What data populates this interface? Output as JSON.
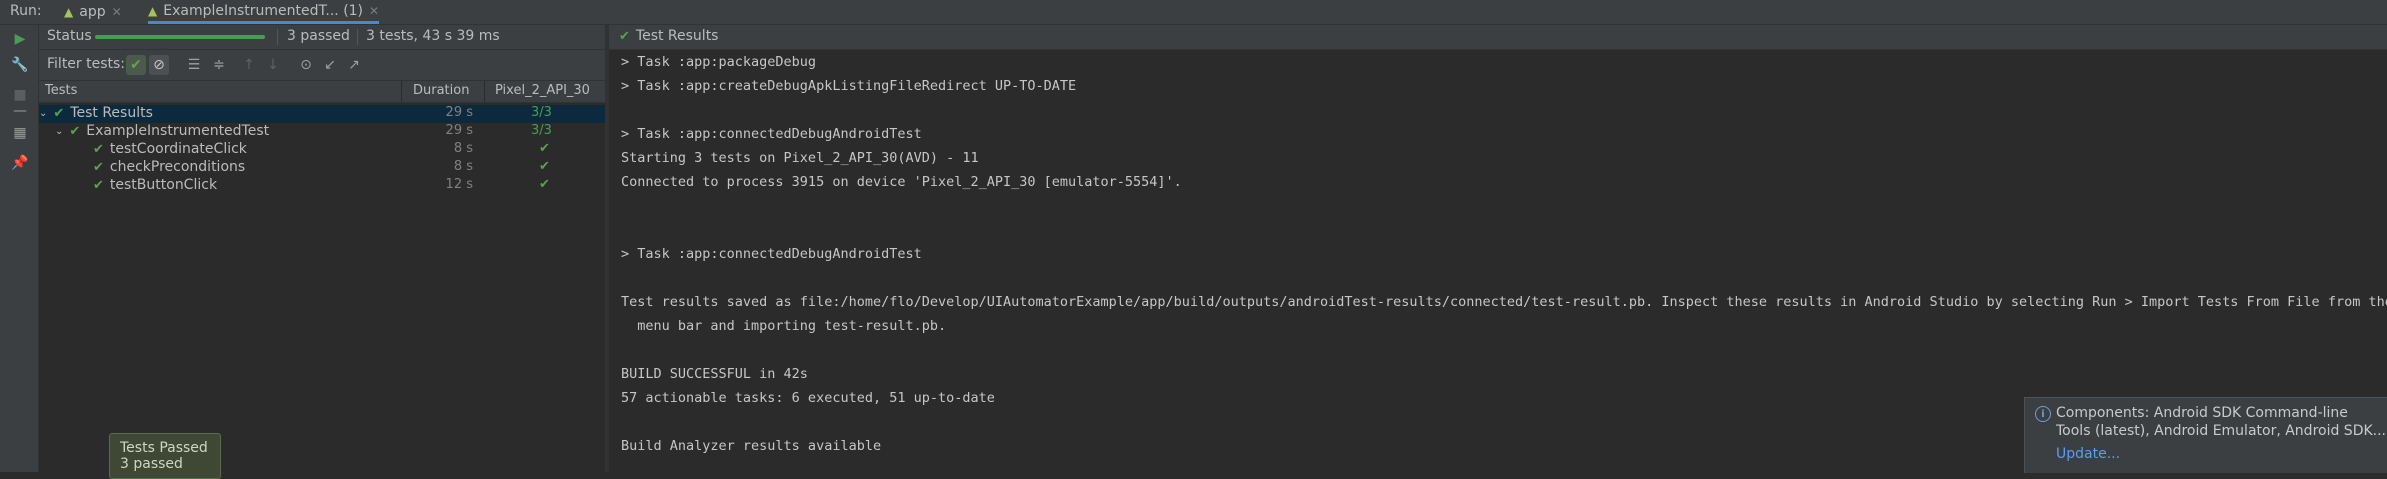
{
  "topbar": {
    "run_label": "Run:",
    "tabs": [
      {
        "label": "app"
      },
      {
        "label": "ExampleInstrumentedT... (1)"
      }
    ]
  },
  "status": {
    "label": "Status",
    "progress_fraction": 1.0,
    "passed": "3 passed",
    "summary": "3 tests, 43 s 39 ms"
  },
  "filter": {
    "label": "Filter tests:",
    "show_passed_on": true,
    "show_ignored_on": true
  },
  "table": {
    "columns": [
      "Tests",
      "Duration",
      "Pixel_2_API_30"
    ],
    "rows": [
      {
        "name": "Test Results",
        "duration": "29 s",
        "result": "3/3",
        "level": 0
      },
      {
        "name": "ExampleInstrumentedTest",
        "duration": "29 s",
        "result": "3/3",
        "level": 1
      },
      {
        "name": "testCoordinateClick",
        "duration": "8 s",
        "result": "",
        "level": 2
      },
      {
        "name": "checkPreconditions",
        "duration": "8 s",
        "result": "",
        "level": 2
      },
      {
        "name": "testButtonClick",
        "duration": "12 s",
        "result": "",
        "level": 2
      }
    ]
  },
  "tooltip": {
    "title": "Tests Passed",
    "detail": "3 passed"
  },
  "console": {
    "header": "Test Results",
    "lines": [
      "> Task :app:packageDebug",
      "> Task :app:createDebugApkListingFileRedirect UP-TO-DATE",
      "",
      "> Task :app:connectedDebugAndroidTest",
      "Starting 3 tests on Pixel_2_API_30(AVD) - 11",
      "Connected to process 3915 on device 'Pixel_2_API_30 [emulator-5554]'.",
      "",
      "",
      "> Task :app:connectedDebugAndroidTest",
      "",
      "Test results saved as file:/home/flo/Develop/UIAutomatorExample/app/build/outputs/androidTest-results/connected/test-result.pb. Inspect these results in Android Studio by selecting Run > Import Tests From File from the",
      "  menu bar and importing test-result.pb.",
      "",
      "BUILD SUCCESSFUL in 42s",
      "57 actionable tasks: 6 executed, 51 up-to-date",
      "",
      "Build Analyzer results available"
    ]
  },
  "notification": {
    "message": "Components: Android SDK Command-line Tools (latest), Android Emulator, Android SDK...",
    "link": "Update..."
  },
  "colors": {
    "accent_green": "#499c54",
    "selection": "#0d293e",
    "link_blue": "#589df6"
  }
}
